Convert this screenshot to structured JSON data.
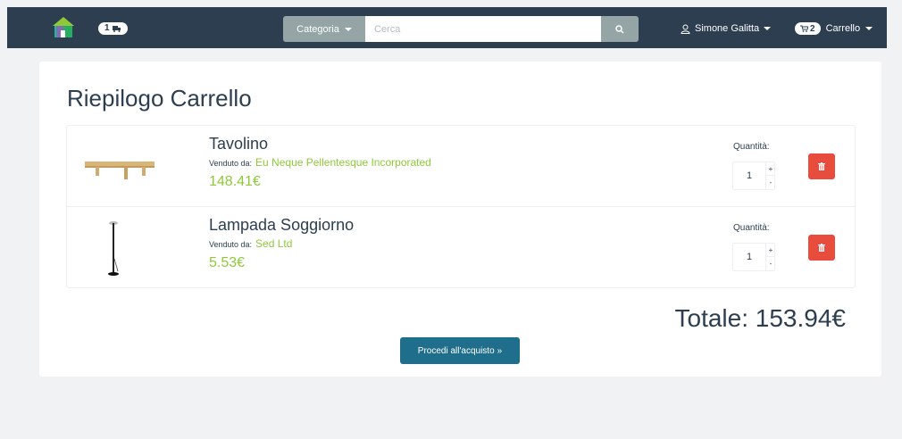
{
  "navbar": {
    "shipments_badge": "1",
    "category_label": "Categoria",
    "search_placeholder": "Cerca",
    "user_name": "Simone Galitta",
    "cart_count": "2",
    "cart_label": "Carrello"
  },
  "page": {
    "title": "Riepilogo Carrello",
    "quantity_label": "Quantità:",
    "sold_by_label": "Venduto da:",
    "total_text": "Totale: 153.94€",
    "checkout_label": "Procedi all'acquisto"
  },
  "cart_items": [
    {
      "name": "Tavolino",
      "seller": "Eu Neque Pellentesque Incorporated",
      "price": "148.41€",
      "quantity": "1",
      "image": "coffee-table"
    },
    {
      "name": "Lampada Soggiorno",
      "seller": "Sed Ltd",
      "price": "5.53€",
      "quantity": "1",
      "image": "floor-lamp"
    }
  ],
  "colors": {
    "navbar": "#2c3e50",
    "accent_green": "#8fc93a",
    "danger": "#e74c3c",
    "primary": "#1f6e8c"
  },
  "icons": {
    "logo": "house-logo",
    "truck": "truck-icon",
    "search": "search-icon",
    "user": "user-icon",
    "cart": "cart-icon",
    "trash": "trash-icon"
  }
}
